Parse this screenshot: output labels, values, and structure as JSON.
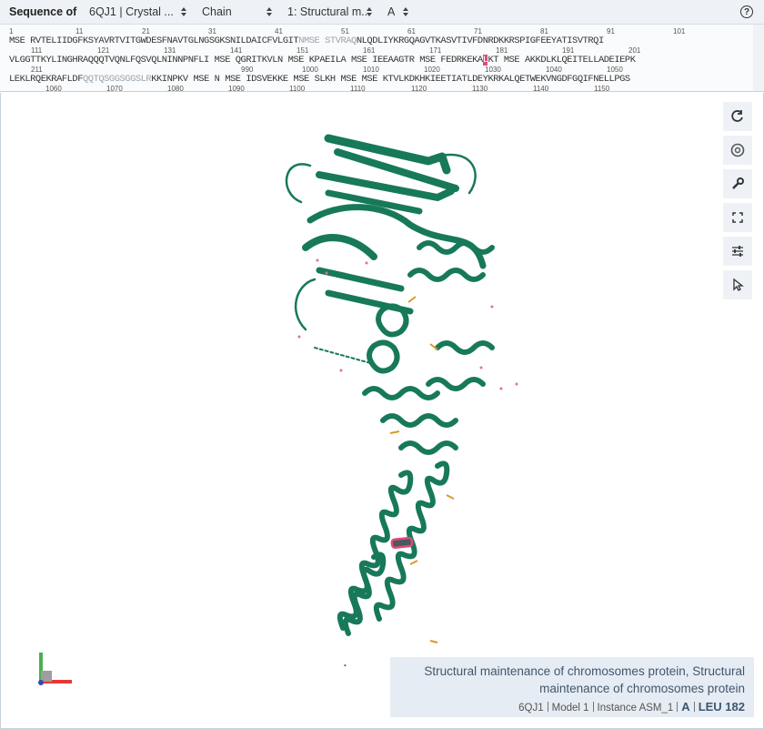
{
  "header": {
    "title": "Sequence of",
    "structure_select": "6QJ1 | Crystal ...",
    "mode_select": "Chain",
    "entity_select": "1: Structural m...",
    "chain_select": "A",
    "help_label": "?"
  },
  "sequence": {
    "row1_numbers": [
      "1",
      "11",
      "21",
      "31",
      "41",
      "51",
      "61",
      "71",
      "81",
      "91",
      "101"
    ],
    "row1_pre": "MSE RVTELIIDGFKSYAVRTVITGWDESFNAVTGLNGSGKSNILDAICFVLGIT",
    "row1_dim": "NMSE STVRAQ",
    "row1_post": "NLQDLIYKRGQAGVTKASVTIVFDNRDKKRSPIGFEEYATISVTRQI",
    "row2_numbers": [
      "111",
      "121",
      "131",
      "141",
      "151",
      "161",
      "171",
      "181",
      "191",
      "201"
    ],
    "row2_pre": "VLGGTTKYLINGHRAQQQTVQNLFQSVQLNINNPNFLI MSE QGRITKVLN MSE KPAEILA MSE IEEAAGTR MSE FEDRKEKA",
    "row2_hl": "L",
    "row2_post": "KT MSE AKKDLKLQEITELLADEIEPK",
    "row3_numbers": [
      "211",
      "990",
      "1000",
      "1010",
      "1020",
      "1030",
      "1040",
      "1050"
    ],
    "row3_pre": "LEKLRQEKRAFLDF",
    "row3_dim": "QQTQSGGSGGSLR",
    "row3_post": "KKINPKV MSE N MSE IDSVEKKE MSE SLKH MSE MSE KTVLKDKHKIEETIATLDEYKRKALQETWEKVNGDFGQIFNELLPGS",
    "row4_numbers": [
      "1060",
      "1070",
      "1080",
      "1090",
      "1100",
      "1110",
      "1120",
      "1130",
      "1140",
      "1150"
    ]
  },
  "toolbar": {
    "icons": [
      "reset-icon",
      "camera-icon",
      "wrench-icon",
      "expand-icon",
      "sliders-icon",
      "pointer-icon"
    ]
  },
  "info": {
    "title": "Structural maintenance of chromosomes protein, Structural maintenance of chromosomes protein",
    "pdb": "6QJ1",
    "model": "Model 1",
    "instance": "Instance ASM_1",
    "chain": "A",
    "residue": "LEU 182"
  },
  "colors": {
    "ribbon": "#17795a",
    "highlight": "#e04a78",
    "header_bg": "#eef2f7",
    "info_bg": "#e6ecf3",
    "ligand": "#d89a2a"
  }
}
